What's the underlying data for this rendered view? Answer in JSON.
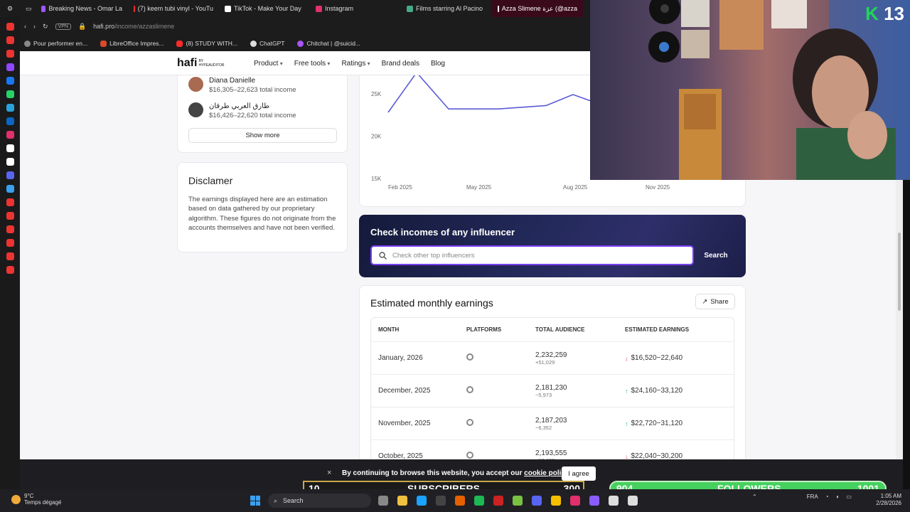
{
  "browser": {
    "tabs": [
      {
        "label": "Breaking News - Omar La",
        "color": "#9b59ff"
      },
      {
        "label": "(7) keem tubi vinyl - YouTu",
        "color": "#ff2b2b"
      },
      {
        "label": "TikTok - Make Your Day",
        "color": "#ffffff"
      },
      {
        "label": "Instagram",
        "color": "#e1306c"
      },
      {
        "label": "Films starring Al Pacino",
        "color": "#44aa88"
      },
      {
        "label": "Azza Slimene عزة (@azza",
        "color": "#ffffff"
      }
    ],
    "url_host": "hafi.pro",
    "url_path": "/income/azzaslimene",
    "vpn": "VPN",
    "bookmarks": [
      {
        "label": "Pour performer en...",
        "color": "#888"
      },
      {
        "label": "LibreOffice Impres...",
        "color": "#d94a2b"
      },
      {
        "label": "(8) STUDY WITH...",
        "color": "#ff2b2b"
      },
      {
        "label": "ChatGPT",
        "color": "#ddd"
      },
      {
        "label": "Chitchat | @suicid...",
        "color": "#a855f7"
      }
    ],
    "sidebar_icons": [
      "#e33",
      "#e33",
      "#e33",
      "#9146ff",
      "#1877f2",
      "#25d366",
      "#2aa1da",
      "#0a66c2",
      "#e1306c",
      "#fff",
      "#fff",
      "#5865f2",
      "#3aa0f0",
      "#e33",
      "#e33",
      "#e33",
      "#e33",
      "#e33",
      "#e33"
    ]
  },
  "site": {
    "logo": "hafi",
    "logo_sub": "BY HYPEAUDITOR",
    "nav": [
      "Product",
      "Free tools",
      "Ratings",
      "Brand deals",
      "Blog"
    ],
    "people": [
      {
        "name": "Diana Danielle",
        "income": "$16,305–22,623 total income",
        "color": "#a86a50"
      },
      {
        "name": "طارق العربي طرقان",
        "income": "$16,426–22,620 total income",
        "color": "#444"
      }
    ],
    "show_more": "Show more",
    "disclaimer_title": "Disclamer",
    "disclaimer_text": "The earnings displayed here are an estimation based on data gathered by our proprietary algorithm. These figures do not originate from the accounts themselves and have not been verified.",
    "search_title": "Check incomes of any influencer",
    "search_placeholder": "Check other top influencers",
    "search_button": "Search",
    "earnings_title": "Estimated monthly earnings",
    "share": "Share",
    "table_headers": [
      "MONTH",
      "PLATFORMS",
      "TOTAL AUDIENCE",
      "ESTIMATED EARNINGS"
    ],
    "rows": [
      {
        "month": "January, 2026",
        "audience": "2,232,259",
        "delta": "+51,029",
        "trend": "down",
        "earnings": "$16,520−22,640"
      },
      {
        "month": "December, 2025",
        "audience": "2,181,230",
        "delta": "−5,973",
        "trend": "up",
        "earnings": "$24,160−33,120"
      },
      {
        "month": "November, 2025",
        "audience": "2,187,203",
        "delta": "−6,352",
        "trend": "up",
        "earnings": "$22,720−31,120"
      },
      {
        "month": "October, 2025",
        "audience": "2,193,555",
        "delta": "−10,400",
        "trend": "down",
        "earnings": "$22,040−30,200"
      }
    ],
    "cookie_text": "By continuing to browse this website, you accept our",
    "cookie_link": "cookie policy.",
    "cookie_agree": "I agree",
    "cookie_close": "×"
  },
  "chart_data": {
    "type": "line",
    "x_labels": [
      "Feb 2025",
      "May 2025",
      "Aug 2025",
      "Nov 2025"
    ],
    "y_ticks": [
      "25K",
      "20K",
      "15K"
    ],
    "ylim": [
      15000,
      28000
    ],
    "series": [
      {
        "color": "#5b5bd6",
        "values": [
          22800,
          27500,
          23200,
          23200,
          23600,
          24900,
          24000
        ]
      }
    ]
  },
  "overlay": {
    "subs_left": "10",
    "subs_label": "SUBSCRIBERS",
    "subs_right": "300",
    "subs_progress": 0.0,
    "fol_left": "904",
    "fol_label": "FOLLOWERS",
    "fol_right": "1001",
    "fol_progress": 1.0,
    "cam_badge_k": "K",
    "cam_badge_num": "13"
  },
  "taskbar": {
    "temp": "9°C",
    "weather": "Temps dégagé",
    "search": "Search",
    "lang": "FRA",
    "time": "1:05 AM",
    "date": "2/28/2026",
    "app_colors": [
      "#888",
      "#f0c040",
      "#1aa3ff",
      "#444",
      "#e66000",
      "#1db954",
      "#c22",
      "#7ac143",
      "#5865f2",
      "#f5c000",
      "#e1306c",
      "#8a5cff",
      "#ddd",
      "#ddd"
    ]
  }
}
